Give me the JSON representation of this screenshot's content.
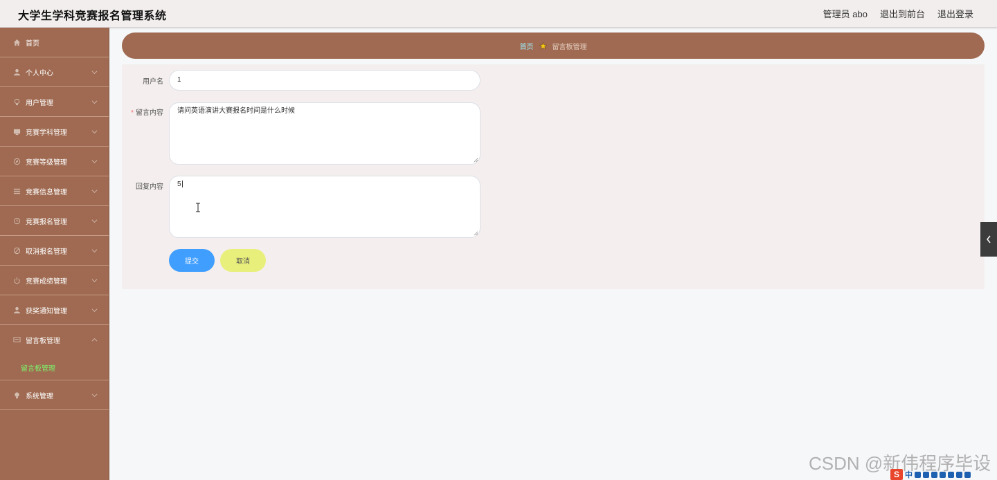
{
  "header": {
    "app_title": "大学生学科竞赛报名管理系统",
    "admin_label": "管理员 abo",
    "to_frontend": "退出到前台",
    "logout": "退出登录"
  },
  "sidebar": {
    "items": [
      {
        "label": "首页",
        "icon": "home-icon"
      },
      {
        "label": "个人中心",
        "icon": "user-icon"
      },
      {
        "label": "用户管理",
        "icon": "bulb-icon"
      },
      {
        "label": "竞赛学科管理",
        "icon": "monitor-icon"
      },
      {
        "label": "竞赛等级管理",
        "icon": "compass-icon"
      },
      {
        "label": "竞赛信息管理",
        "icon": "list-icon"
      },
      {
        "label": "竞赛报名管理",
        "icon": "clock-icon"
      },
      {
        "label": "取消报名管理",
        "icon": "disabled-icon"
      },
      {
        "label": "竞赛成绩管理",
        "icon": "power-icon"
      },
      {
        "label": "获奖通知管理",
        "icon": "user-icon"
      },
      {
        "label": "留言板管理",
        "icon": "message-icon"
      },
      {
        "label": "系统管理",
        "icon": "bulb-icon"
      }
    ],
    "submenu_active": "留言板管理"
  },
  "breadcrumb": {
    "home": "首页",
    "current": "留言板管理"
  },
  "form": {
    "username_label": "用户名",
    "username_value": "1",
    "content_label": "留言内容",
    "content_value": "请问英语演讲大赛报名时间是什么时候",
    "reply_label": "回复内容",
    "reply_value": "5",
    "submit_label": "提交",
    "cancel_label": "取消"
  },
  "watermark": "CSDN @新伟程序毕设",
  "ime": {
    "logo": "S",
    "mode": "中"
  },
  "colors": {
    "sidebar": "#9f6a51",
    "panel": "#f4efee",
    "submit": "#409eff",
    "cancel": "#e8ef7a",
    "active_sub": "#7ef06c",
    "crumb_home": "#9ff0ff"
  }
}
